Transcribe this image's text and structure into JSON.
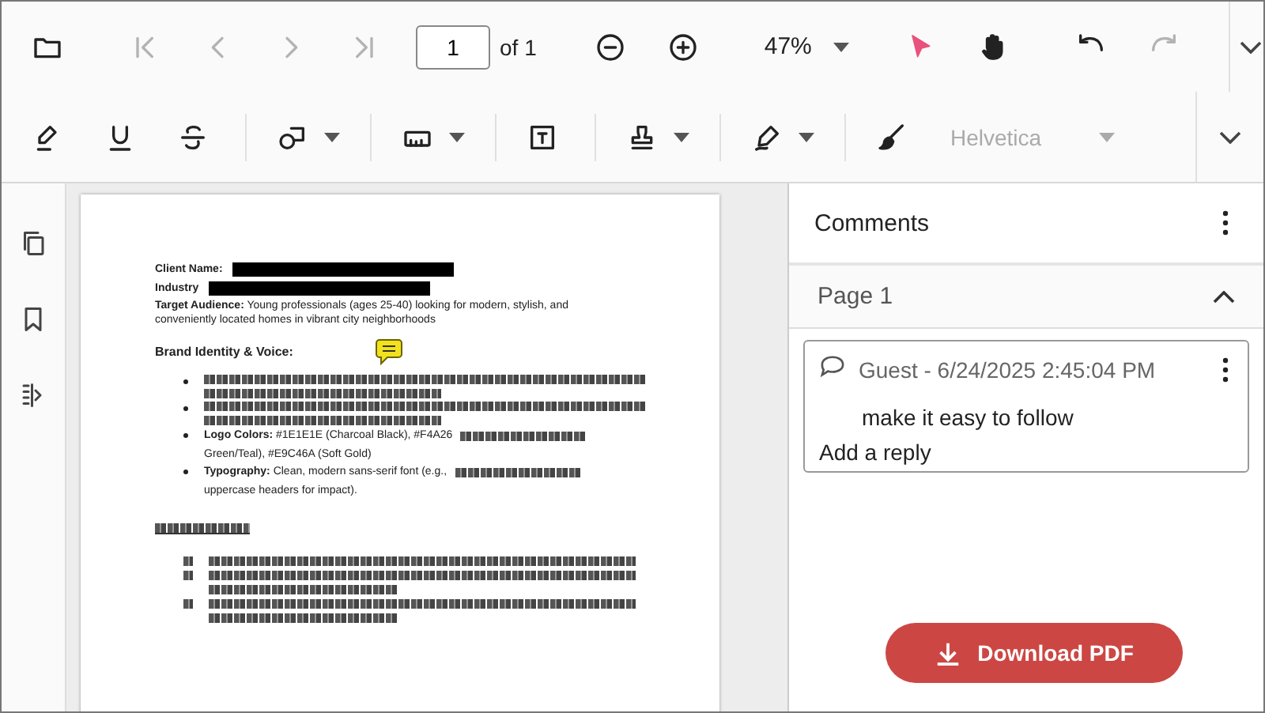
{
  "toolbar": {
    "rows": [
      {
        "items": [
          {
            "kind": "tool",
            "disabled": false,
            "selected": false,
            "dropdown": false
          },
          {
            "kind": "separator"
          },
          {
            "kind": "tool",
            "disabled": true,
            "selected": false,
            "dropdown": false
          },
          {
            "kind": "tool",
            "disabled": true,
            "selected": false,
            "dropdown": false
          },
          {
            "kind": "tool",
            "disabled": true,
            "selected": false,
            "dropdown": false
          },
          {
            "kind": "tool",
            "disabled": true,
            "selected": false,
            "dropdown": false
          },
          {
            "kind": "page_input",
            "value": "1"
          },
          {
            "kind": "label",
            "text": "of 1"
          },
          {
            "kind": "separator"
          },
          {
            "kind": "tool",
            "disabled": false,
            "selected": false,
            "dropdown": false
          },
          {
            "kind": "tool",
            "disabled": false,
            "selected": false,
            "dropdown": false
          },
          {
            "kind": "zoom",
            "text": "47%"
          },
          {
            "kind": "separator"
          },
          {
            "kind": "tool",
            "disabled": false,
            "selected": true,
            "dropdown": false
          },
          {
            "kind": "tool",
            "disabled": false,
            "selected": false,
            "dropdown": false
          },
          {
            "kind": "separator"
          },
          {
            "kind": "tool",
            "disabled": false,
            "selected": false,
            "dropdown": false
          },
          {
            "kind": "tool",
            "disabled": true,
            "selected": false,
            "dropdown": false
          },
          {
            "kind": "separator"
          },
          {
            "kind": "overflow"
          }
        ]
      },
      {
        "items": [
          {
            "kind": "tool",
            "disabled": false,
            "selected": false,
            "dropdown": false
          },
          {
            "kind": "tool",
            "disabled": false,
            "selected": false,
            "dropdown": false
          },
          {
            "kind": "tool",
            "disabled": false,
            "selected": false,
            "dropdown": false
          },
          {
            "kind": "separator"
          },
          {
            "kind": "tool",
            "disabled": false,
            "selected": false,
            "dropdown": true
          },
          {
            "kind": "separator"
          },
          {
            "kind": "tool",
            "disabled": false,
            "selected": false,
            "dropdown": true
          },
          {
            "kind": "separator"
          },
          {
            "kind": "tool",
            "disabled": false,
            "selected": false,
            "dropdown": false
          },
          {
            "kind": "separator"
          },
          {
            "kind": "tool",
            "disabled": false,
            "selected": false,
            "dropdown": true
          },
          {
            "kind": "separator"
          },
          {
            "kind": "tool",
            "disabled": false,
            "selected": false,
            "dropdown": true
          },
          {
            "kind": "separator"
          },
          {
            "kind": "tool",
            "disabled": false,
            "selected": false,
            "dropdown": false
          },
          {
            "kind": "font",
            "text": "Helvetica",
            "disabled": true
          },
          {
            "kind": "overflow"
          }
        ]
      }
    ]
  },
  "document": {
    "blocks": [
      {
        "kind": "field",
        "label": "Client Name:",
        "redacted": true
      },
      {
        "kind": "field",
        "label": "Industry",
        "redacted": true
      },
      {
        "kind": "paragraph",
        "text": "**Target Audience:** Young professionals (ages 25-40) looking for modern, stylish, and conveniently located homes in vibrant city neighborhoods"
      },
      {
        "kind": "heading",
        "text": "Brand Identity & Voice:"
      },
      {
        "kind": "illegible_bullet"
      },
      {
        "kind": "illegible_bullet"
      },
      {
        "kind": "bullet",
        "text": "**Logo Colors:** #1E1E1E (Charcoal Black), #F4A26",
        "illegible_tail": true,
        "more": "Green/Teal), #E9C46A (Soft Gold)"
      },
      {
        "kind": "bullet",
        "text": "**Typography:** Clean, modern sans-serif font (e.g.,",
        "illegible_tail": true,
        "more": "uppercase headers for impact)."
      },
      {
        "kind": "illegible_heading"
      },
      {
        "kind": "illegible_list"
      }
    ]
  },
  "comments": {
    "title": "Comments",
    "section": {
      "label": "Page 1",
      "expanded": true
    },
    "items": [
      {
        "author_time": "Guest - 6/24/2025 2:45:04 PM",
        "text": "make it easy to follow",
        "reply_placeholder": "Add a reply"
      }
    ]
  },
  "download_button": "Download PDF"
}
